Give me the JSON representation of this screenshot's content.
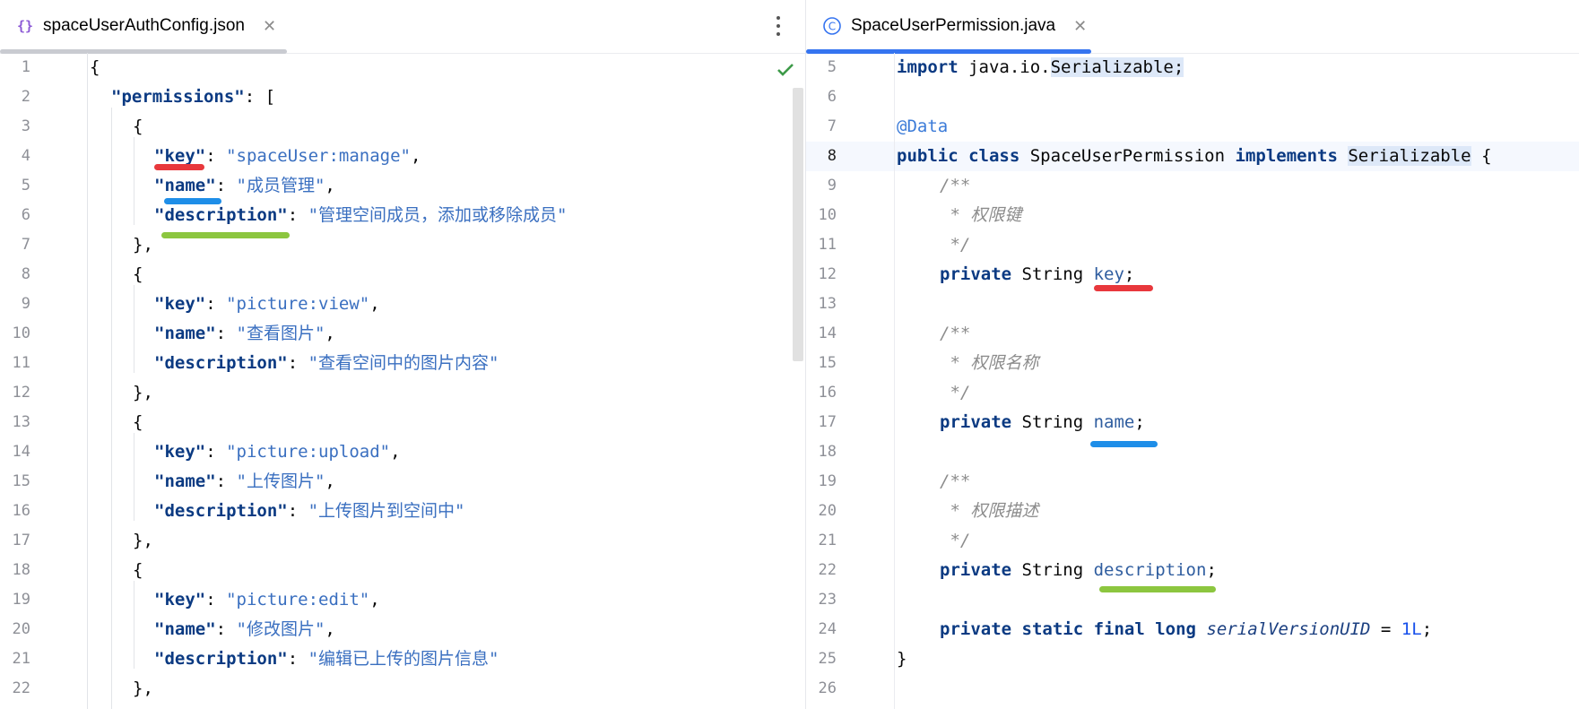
{
  "left_editor": {
    "tab": {
      "icon": "json-braces-icon",
      "label": "spaceUserAuthConfig.json",
      "close": "✕"
    },
    "line_numbers": [
      "1",
      "2",
      "3",
      "4",
      "5",
      "6",
      "7",
      "8",
      "9",
      "10",
      "11",
      "12",
      "13",
      "14",
      "15",
      "16",
      "17",
      "18",
      "19",
      "20",
      "21",
      "22"
    ],
    "code": {
      "l1": "{",
      "l2_key": "\"permissions\"",
      "l2_rest": ": [",
      "open_brace": "{",
      "close_brace": "},",
      "key_label": "\"key\"",
      "name_label": "\"name\"",
      "desc_label": "\"description\"",
      "colon": ": ",
      "comma": ",",
      "items": [
        {
          "key": "\"spaceUser:manage\"",
          "name": "\"成员管理\"",
          "description": "\"管理空间成员，添加或移除成员\""
        },
        {
          "key": "\"picture:view\"",
          "name": "\"查看图片\"",
          "description": "\"查看空间中的图片内容\""
        },
        {
          "key": "\"picture:upload\"",
          "name": "\"上传图片\"",
          "description": "\"上传图片到空间中\""
        },
        {
          "key": "\"picture:edit\"",
          "name": "\"修改图片\"",
          "description": "\"编辑已上传的图片信息\""
        }
      ]
    }
  },
  "right_editor": {
    "tab": {
      "icon": "class-c-icon",
      "icon_glyph": "C",
      "label": "SpaceUserPermission.java",
      "close": "✕"
    },
    "line_numbers": [
      "5",
      "6",
      "7",
      "8",
      "9",
      "10",
      "11",
      "12",
      "13",
      "14",
      "15",
      "16",
      "17",
      "18",
      "19",
      "20",
      "21",
      "22",
      "23",
      "24",
      "25",
      "26"
    ],
    "code": {
      "import_kw": "import",
      "import_pkg": " java.io.",
      "import_class": "Serializable",
      "import_end": ";",
      "annotation": "@Data",
      "public_kw": "public",
      "class_kw": " class",
      "class_name": " SpaceUserPermission ",
      "implements_kw": "implements",
      "space": " ",
      "iface": "Serializable",
      "brace_open": " {",
      "doc_open": "/**",
      "doc_key": " * 权限键",
      "doc_name": " * 权限名称",
      "doc_desc": " * 权限描述",
      "doc_close": " */",
      "private_kw": "private",
      "string_type": " String ",
      "field_key": "key",
      "field_name": "name",
      "field_desc": "description",
      "semicolon": ";",
      "static_final_long": "private static final long",
      "serial_field": "serialVersionUID",
      "equals": " = ",
      "serial_value": "1L",
      "brace_close": "}"
    }
  },
  "colors": {
    "key_mark": "#e8383c",
    "name_mark": "#1e8ee8",
    "description_mark": "#8cc63f",
    "active_tab": "#3574f0",
    "inactive_tab": "#c9cbd1"
  }
}
